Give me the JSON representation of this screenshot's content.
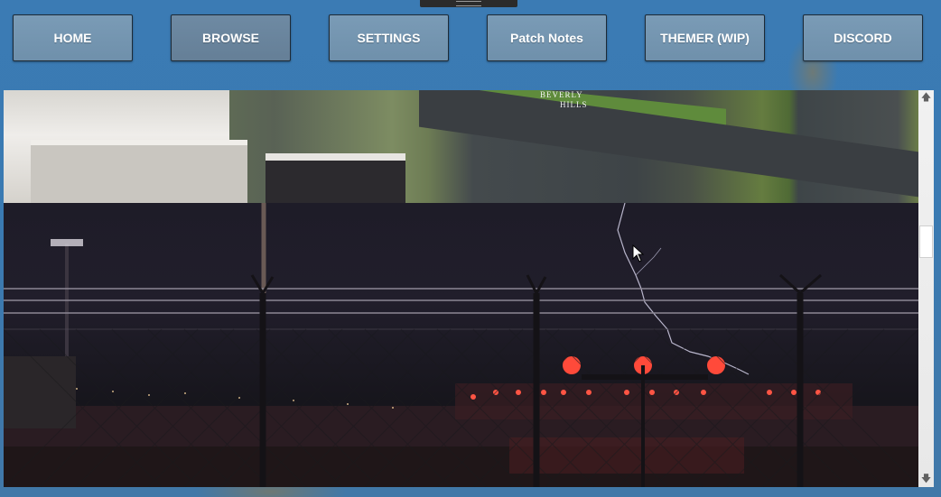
{
  "nav": {
    "items": [
      {
        "label": "HOME"
      },
      {
        "label": "BROWSE"
      },
      {
        "label": "SETTINGS"
      },
      {
        "label": "Patch Notes"
      },
      {
        "label": "THEMER (WIP)"
      },
      {
        "label": "DISCORD"
      }
    ]
  },
  "gallery": {
    "city_tile": {
      "sign_text_line1": "BEVERLY",
      "sign_text_line2": "HILLS"
    }
  },
  "scrollbar": {
    "up_icon": "arrow-up-icon",
    "down_icon": "arrow-down-icon",
    "scroll_fraction": 0.36
  },
  "colors": {
    "nav_button": "#7393ae",
    "nav_border": "#1d2a36",
    "background": "#3b7bb4"
  }
}
